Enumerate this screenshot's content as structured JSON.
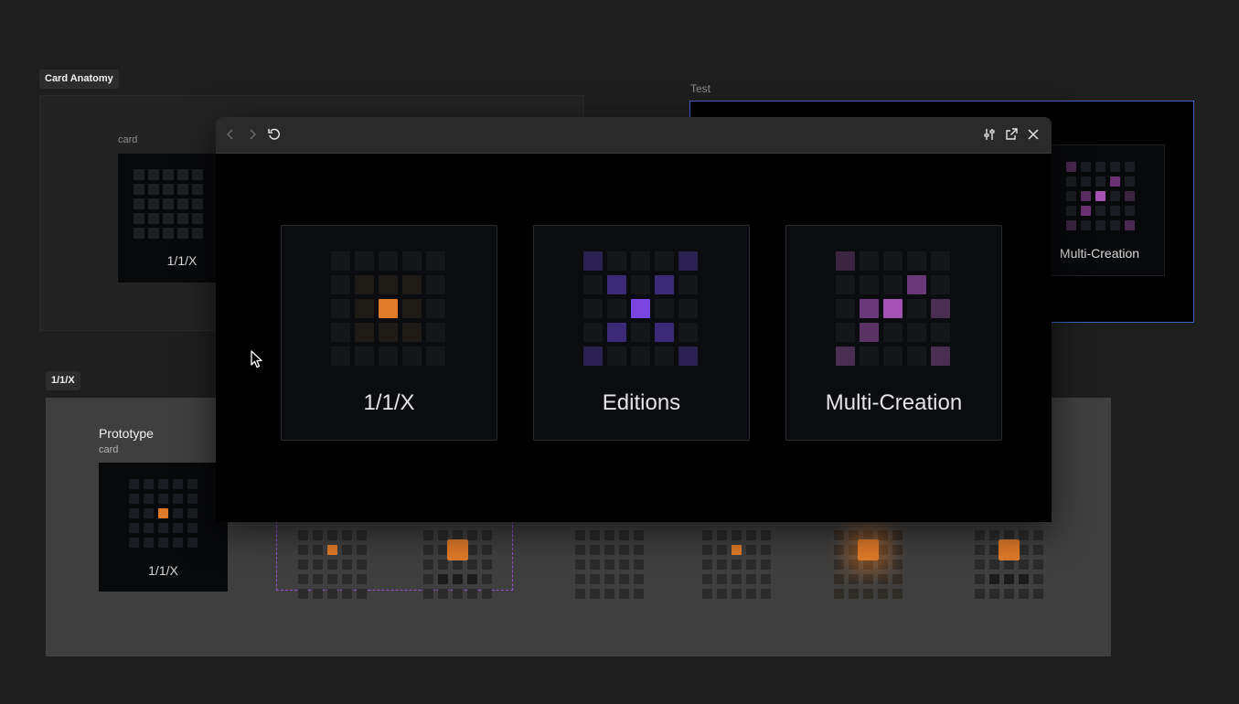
{
  "frames": {
    "card_anatomy": {
      "label": "Card Anatomy",
      "card_label": "card",
      "card_caption": "1/1/X"
    },
    "test": {
      "label": "Test",
      "card_caption": "Multi-Creation"
    },
    "one_one_x": {
      "label": "1/1/X",
      "prototype_title": "Prototype",
      "prototype_sub": "card",
      "card_caption": "1/1/X"
    }
  },
  "modal": {
    "toolbar": {
      "back_icon": "chevron-left-icon",
      "forward_icon": "chevron-right-icon",
      "reload_icon": "rotate-ccw-icon",
      "settings_icon": "sliders-icon",
      "open_external_icon": "external-link-icon",
      "close_icon": "close-icon"
    },
    "options": [
      {
        "label": "1/1/X",
        "accent": "#e07b2a"
      },
      {
        "label": "Editions",
        "accent": "#7a45e0"
      },
      {
        "label": "Multi-Creation",
        "accent": "#a552b5"
      }
    ]
  },
  "colors": {
    "background": "#1e1e1e",
    "modal_bg": "#000000",
    "orange": "#e07b2a",
    "purple": "#7a45e0",
    "magenta": "#a552b5",
    "selection_border": "#3c63c9"
  },
  "cursor": "mouse-pointer-icon"
}
